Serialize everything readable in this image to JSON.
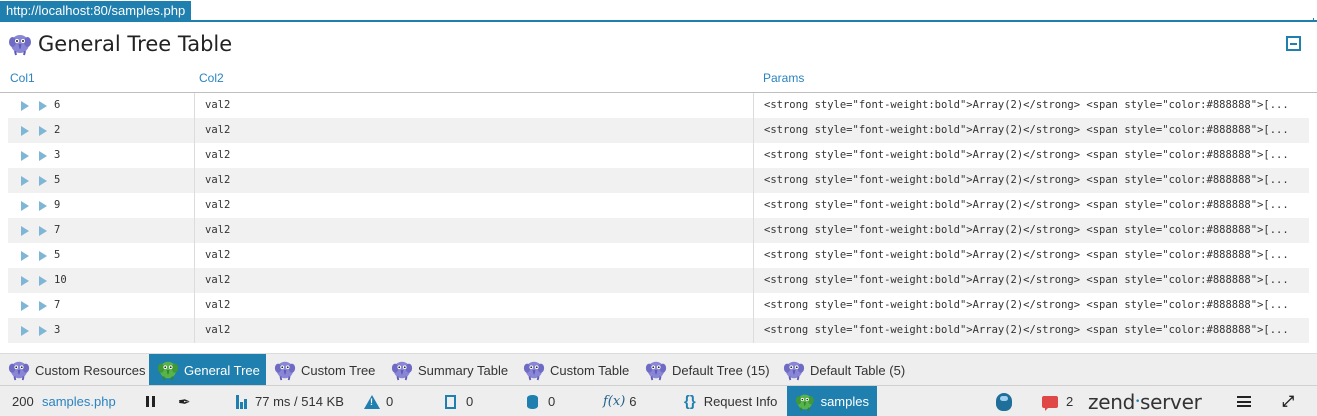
{
  "url_tab": "http://localhost:80/samples.php",
  "panel": {
    "title": "General Tree Table"
  },
  "table": {
    "columns": [
      "Col1",
      "Col2",
      "Params"
    ],
    "rows": [
      {
        "col1": "6",
        "col2": "val2",
        "params": "<strong style=\"font-weight:bold\">Array(2)</strong> <span style=\"color:#888888\">[..."
      },
      {
        "col1": "2",
        "col2": "val2",
        "params": "<strong style=\"font-weight:bold\">Array(2)</strong> <span style=\"color:#888888\">[..."
      },
      {
        "col1": "3",
        "col2": "val2",
        "params": "<strong style=\"font-weight:bold\">Array(2)</strong> <span style=\"color:#888888\">[..."
      },
      {
        "col1": "5",
        "col2": "val2",
        "params": "<strong style=\"font-weight:bold\">Array(2)</strong> <span style=\"color:#888888\">[..."
      },
      {
        "col1": "9",
        "col2": "val2",
        "params": "<strong style=\"font-weight:bold\">Array(2)</strong> <span style=\"color:#888888\">[..."
      },
      {
        "col1": "7",
        "col2": "val2",
        "params": "<strong style=\"font-weight:bold\">Array(2)</strong> <span style=\"color:#888888\">[..."
      },
      {
        "col1": "5",
        "col2": "val2",
        "params": "<strong style=\"font-weight:bold\">Array(2)</strong> <span style=\"color:#888888\">[..."
      },
      {
        "col1": "10",
        "col2": "val2",
        "params": "<strong style=\"font-weight:bold\">Array(2)</strong> <span style=\"color:#888888\">[..."
      },
      {
        "col1": "7",
        "col2": "val2",
        "params": "<strong style=\"font-weight:bold\">Array(2)</strong> <span style=\"color:#888888\">[..."
      },
      {
        "col1": "3",
        "col2": "val2",
        "params": "<strong style=\"font-weight:bold\">Array(2)</strong> <span style=\"color:#888888\">[..."
      }
    ]
  },
  "tabs": [
    {
      "label": "Custom Resources",
      "active": false
    },
    {
      "label": "General Tree",
      "active": true
    },
    {
      "label": "Custom Tree",
      "active": false
    },
    {
      "label": "Summary Table",
      "active": false
    },
    {
      "label": "Custom Table",
      "active": false
    },
    {
      "label": "Default Tree (15)",
      "active": false
    },
    {
      "label": "Default Table (5)",
      "active": false
    }
  ],
  "statusbar": {
    "status_code": "200",
    "script_name": "samples.php",
    "timing": "77 ms / 514 KB",
    "warnings": "0",
    "logs": "0",
    "queries": "0",
    "functions": "6",
    "request_info": "Request Info",
    "samples_label": "samples",
    "notifications": "2",
    "brand": "zend",
    "brand_suffix": "server"
  },
  "colors": {
    "accent": "#1f7fae",
    "link": "#2a84c0",
    "alt_row": "#f1f1f1",
    "notification": "#e04848"
  },
  "icons": [
    "elephant-logo",
    "collapse-icon",
    "expand-arrow",
    "pause-icon",
    "pin-icon",
    "chart-bars-icon",
    "warning-icon",
    "document-icon",
    "database-icon",
    "function-icon",
    "braces-icon",
    "bug-icon",
    "chat-icon",
    "menu-icon",
    "shrink-icon"
  ]
}
